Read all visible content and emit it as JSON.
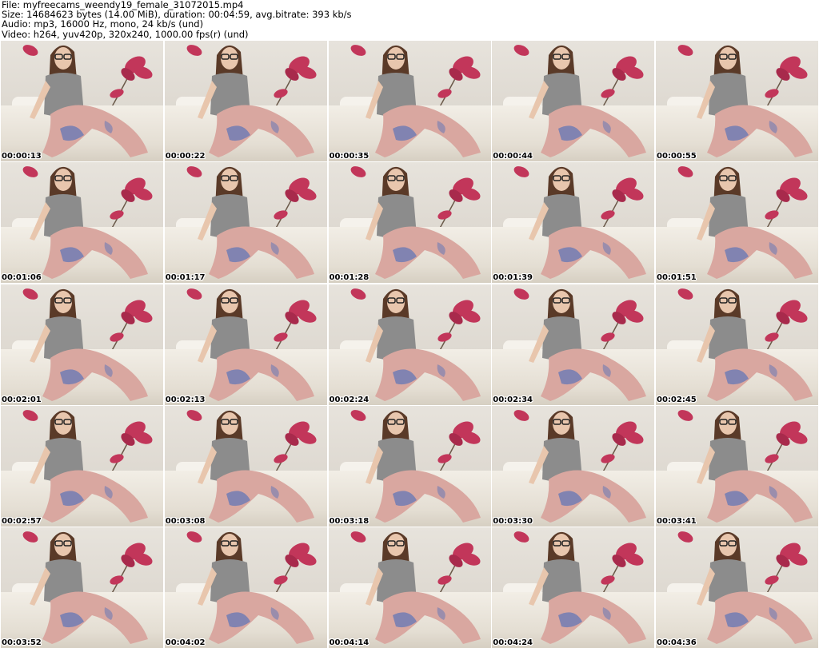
{
  "header": {
    "file_line": "File: myfreecams_weendy19_female_31072015.mp4",
    "size_line": "Size: 14684623 bytes (14.00 MiB), duration: 00:04:59, avg.bitrate: 393 kb/s",
    "audio_line": "Audio: mp3, 16000 Hz, mono, 24 kb/s (und)",
    "video_line": "Video: h264, yuv420p, 320x240, 1000.00 fps(r) (und)"
  },
  "thumbnails": [
    {
      "timestamp": "00:00:13"
    },
    {
      "timestamp": "00:00:22"
    },
    {
      "timestamp": "00:00:35"
    },
    {
      "timestamp": "00:00:44"
    },
    {
      "timestamp": "00:00:55"
    },
    {
      "timestamp": "00:01:06"
    },
    {
      "timestamp": "00:01:17"
    },
    {
      "timestamp": "00:01:28"
    },
    {
      "timestamp": "00:01:39"
    },
    {
      "timestamp": "00:01:51"
    },
    {
      "timestamp": "00:02:01"
    },
    {
      "timestamp": "00:02:13"
    },
    {
      "timestamp": "00:02:24"
    },
    {
      "timestamp": "00:02:34"
    },
    {
      "timestamp": "00:02:45"
    },
    {
      "timestamp": "00:02:57"
    },
    {
      "timestamp": "00:03:08"
    },
    {
      "timestamp": "00:03:18"
    },
    {
      "timestamp": "00:03:30"
    },
    {
      "timestamp": "00:03:41"
    },
    {
      "timestamp": "00:03:52"
    },
    {
      "timestamp": "00:04:02"
    },
    {
      "timestamp": "00:04:14"
    },
    {
      "timestamp": "00:04:24"
    },
    {
      "timestamp": "00:04:36"
    }
  ],
  "colors": {
    "background": "#ffffff",
    "text": "#000000",
    "wall": "#e2ddd5",
    "flower": "#c2365a",
    "shirt": "#8c8c8c",
    "leggings": "#d9a7a0",
    "hair": "#5a3a28"
  }
}
